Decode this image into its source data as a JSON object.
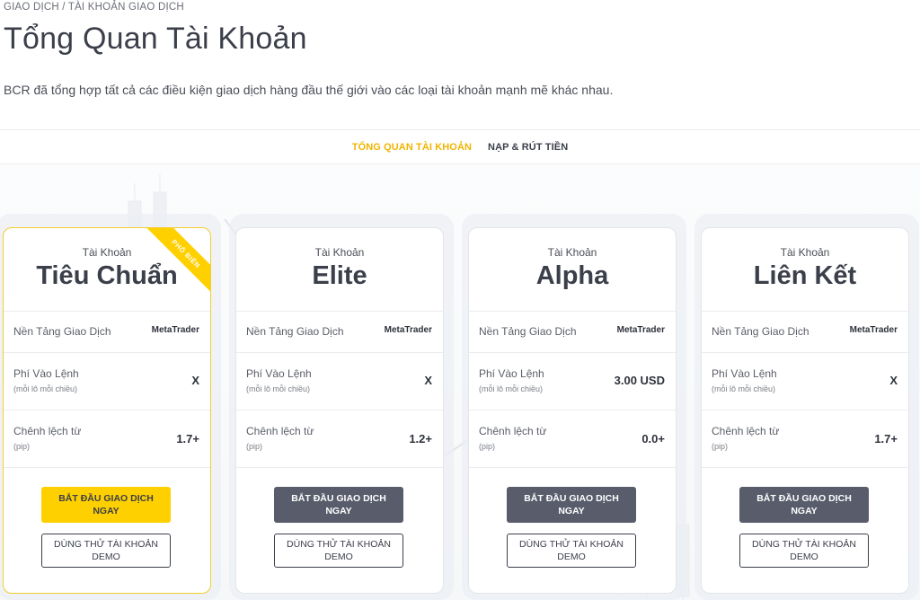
{
  "breadcrumb": "GIAO DỊCH / TÀI KHOẢN GIAO DỊCH",
  "page_title": "Tổng Quan Tài Khoản",
  "intro": "BCR đã tổng hợp tất cả các điều kiện giao dịch hàng đầu thế giới vào các loại tài khoản mạnh mẽ khác nhau.",
  "tabs": [
    {
      "label": "TỔNG QUAN TÀI KHOẢN"
    },
    {
      "label": "NẠP & RÚT TIỀN"
    }
  ],
  "colors": {
    "accent": "#ffd000",
    "tab_active": "#f0b400",
    "dark_button": "#585c6b"
  },
  "cards": [
    {
      "kicker": "Tài Khoản",
      "name": "Tiêu Chuẩn",
      "badge": "PHỔ BIẾN",
      "platform_label": "Nền Tảng Giao Dịch",
      "platform_value": "MetaTrader",
      "fee_label": "Phí Vào Lệnh",
      "fee_sub": "(mỗi lô mỗi chiều)",
      "fee_value": "X",
      "spread_label": "Chênh lệch từ",
      "spread_sub": "(pip)",
      "spread_value": "1.7+",
      "cta": "BẮT ĐẦU GIAO DỊCH NGAY",
      "demo": "DÙNG THỬ TÀI KHOẢN DEMO"
    },
    {
      "kicker": "Tài Khoản",
      "name": "Elite",
      "platform_label": "Nền Tảng Giao Dịch",
      "platform_value": "MetaTrader",
      "fee_label": "Phí Vào Lệnh",
      "fee_sub": "(mỗi lô mỗi chiều)",
      "fee_value": "X",
      "spread_label": "Chênh lệch từ",
      "spread_sub": "(pip)",
      "spread_value": "1.2+",
      "cta": "BẮT ĐẦU GIAO DỊCH NGAY",
      "demo": "DÙNG THỬ TÀI KHOẢN DEMO"
    },
    {
      "kicker": "Tài Khoản",
      "name": "Alpha",
      "platform_label": "Nền Tảng Giao Dịch",
      "platform_value": "MetaTrader",
      "fee_label": "Phí Vào Lệnh",
      "fee_sub": "(mỗi lô mỗi chiều)",
      "fee_value": "3.00 USD",
      "spread_label": "Chênh lệch từ",
      "spread_sub": "(pip)",
      "spread_value": "0.0+",
      "cta": "BẮT ĐẦU GIAO DỊCH NGAY",
      "demo": "DÙNG THỬ TÀI KHOẢN DEMO"
    },
    {
      "kicker": "Tài Khoản",
      "name": "Liên Kết",
      "platform_label": "Nền Tảng Giao Dịch",
      "platform_value": "MetaTrader",
      "fee_label": "Phí Vào Lệnh",
      "fee_sub": "(mỗi lô mỗi chiều)",
      "fee_value": "X",
      "spread_label": "Chênh lệch từ",
      "spread_sub": "(pip)",
      "spread_value": "1.7+",
      "cta": "BẮT ĐẦU GIAO DỊCH NGAY",
      "demo": "DÙNG THỬ TÀI KHOẢN DEMO"
    }
  ]
}
